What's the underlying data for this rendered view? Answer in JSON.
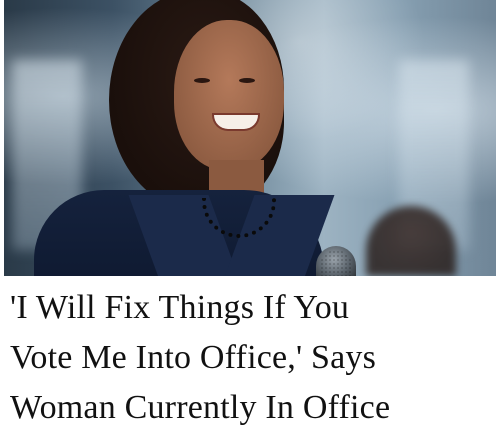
{
  "photo": {
    "subject": "woman-smiling-at-microphone",
    "palette": {
      "jacket": "#15223d",
      "hair": "#1a0f0b",
      "background": "#6d8799"
    }
  },
  "headline": {
    "lines": [
      "'I Will Fix Things If You",
      "Vote Me Into Office,' Says",
      "Woman Currently In Office"
    ]
  }
}
